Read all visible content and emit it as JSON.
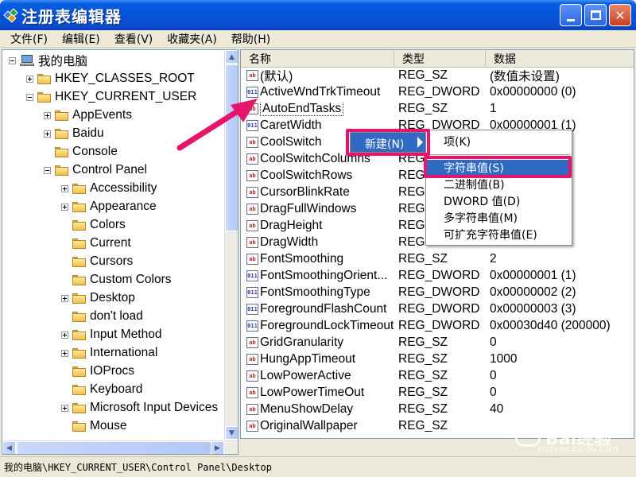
{
  "window": {
    "title": "注册表编辑器",
    "min_label": "",
    "max_label": "",
    "close_label": "✕"
  },
  "menu": [
    "文件(F)",
    "编辑(E)",
    "查看(V)",
    "收藏夹(A)",
    "帮助(H)"
  ],
  "tree": [
    {
      "label": "我的电脑",
      "indent": 0,
      "expander": "minus",
      "icon": "computer-icon"
    },
    {
      "label": "HKEY_CLASSES_ROOT",
      "indent": 1,
      "expander": "plus",
      "icon": "folder-icon"
    },
    {
      "label": "HKEY_CURRENT_USER",
      "indent": 1,
      "expander": "minus",
      "icon": "folder-icon"
    },
    {
      "label": "AppEvents",
      "indent": 2,
      "expander": "plus",
      "icon": "folder-icon"
    },
    {
      "label": "Baidu",
      "indent": 2,
      "expander": "plus",
      "icon": "folder-icon"
    },
    {
      "label": "Console",
      "indent": 2,
      "expander": "none",
      "icon": "folder-icon"
    },
    {
      "label": "Control Panel",
      "indent": 2,
      "expander": "minus",
      "icon": "folder-icon"
    },
    {
      "label": "Accessibility",
      "indent": 3,
      "expander": "plus",
      "icon": "folder-icon"
    },
    {
      "label": "Appearance",
      "indent": 3,
      "expander": "plus",
      "icon": "folder-icon"
    },
    {
      "label": "Colors",
      "indent": 3,
      "expander": "none",
      "icon": "folder-icon"
    },
    {
      "label": "Current",
      "indent": 3,
      "expander": "none",
      "icon": "folder-icon"
    },
    {
      "label": "Cursors",
      "indent": 3,
      "expander": "none",
      "icon": "folder-icon"
    },
    {
      "label": "Custom Colors",
      "indent": 3,
      "expander": "none",
      "icon": "folder-icon"
    },
    {
      "label": "Desktop",
      "indent": 3,
      "expander": "plus",
      "icon": "folder-open-icon"
    },
    {
      "label": "don't load",
      "indent": 3,
      "expander": "none",
      "icon": "folder-icon"
    },
    {
      "label": "Input Method",
      "indent": 3,
      "expander": "plus",
      "icon": "folder-icon"
    },
    {
      "label": "International",
      "indent": 3,
      "expander": "plus",
      "icon": "folder-icon"
    },
    {
      "label": "IOProcs",
      "indent": 3,
      "expander": "none",
      "icon": "folder-icon"
    },
    {
      "label": "Keyboard",
      "indent": 3,
      "expander": "none",
      "icon": "folder-icon"
    },
    {
      "label": "Microsoft Input Devices",
      "indent": 3,
      "expander": "plus",
      "icon": "folder-icon"
    },
    {
      "label": "Mouse",
      "indent": 3,
      "expander": "none",
      "icon": "folder-icon"
    }
  ],
  "columns": {
    "name": "名称",
    "type": "类型",
    "data": "数据"
  },
  "values": [
    {
      "name": "(默认)",
      "type": "REG_SZ",
      "data": "(数值未设置)",
      "kind": "sz"
    },
    {
      "name": "ActiveWndTrkTimeout",
      "type": "REG_DWORD",
      "data": "0x00000000 (0)",
      "kind": "dw"
    },
    {
      "name": "AutoEndTasks",
      "type": "REG_SZ",
      "data": "1",
      "kind": "sz"
    },
    {
      "name": "CaretWidth",
      "type": "REG_DWORD",
      "data": "0x00000001 (1)",
      "kind": "dw"
    },
    {
      "name": "CoolSwitch",
      "type": "",
      "data": "",
      "kind": "sz"
    },
    {
      "name": "CoolSwitchColumns",
      "type": "REG",
      "data": "",
      "kind": "sz"
    },
    {
      "name": "CoolSwitchRows",
      "type": "REG",
      "data": "",
      "kind": "sz"
    },
    {
      "name": "CursorBlinkRate",
      "type": "REG",
      "data": "",
      "kind": "sz"
    },
    {
      "name": "DragFullWindows",
      "type": "REG",
      "data": "",
      "kind": "sz"
    },
    {
      "name": "DragHeight",
      "type": "REG",
      "data": "",
      "kind": "sz"
    },
    {
      "name": "DragWidth",
      "type": "REG",
      "data": "",
      "kind": "sz"
    },
    {
      "name": "FontSmoothing",
      "type": "REG_SZ",
      "data": "2",
      "kind": "sz"
    },
    {
      "name": "FontSmoothingOrient...",
      "type": "REG_DWORD",
      "data": "0x00000001 (1)",
      "kind": "dw"
    },
    {
      "name": "FontSmoothingType",
      "type": "REG_DWORD",
      "data": "0x00000002 (2)",
      "kind": "dw"
    },
    {
      "name": "ForegroundFlashCount",
      "type": "REG_DWORD",
      "data": "0x00000003 (3)",
      "kind": "dw"
    },
    {
      "name": "ForegroundLockTimeout",
      "type": "REG_DWORD",
      "data": "0x00030d40 (200000)",
      "kind": "dw"
    },
    {
      "name": "GridGranularity",
      "type": "REG_SZ",
      "data": "0",
      "kind": "sz"
    },
    {
      "name": "HungAppTimeout",
      "type": "REG_SZ",
      "data": "1000",
      "kind": "sz"
    },
    {
      "name": "LowPowerActive",
      "type": "REG_SZ",
      "data": "0",
      "kind": "sz"
    },
    {
      "name": "LowPowerTimeOut",
      "type": "REG_SZ",
      "data": "0",
      "kind": "sz"
    },
    {
      "name": "MenuShowDelay",
      "type": "REG_SZ",
      "data": "40",
      "kind": "sz"
    },
    {
      "name": "OriginalWallpaper",
      "type": "REG_SZ",
      "data": "",
      "kind": "sz"
    }
  ],
  "context_menu": {
    "new_label": "新建(N)"
  },
  "submenu": [
    "项(K)",
    "字符串值(S)",
    "二进制值(B)",
    "DWORD 值(D)",
    "多字符串值(M)",
    "可扩充字符串值(E)"
  ],
  "status": "我的电脑\\HKEY_CURRENT_USER\\Control Panel\\Desktop",
  "watermark": {
    "brand": "Bai经验",
    "url": "jingyan.baidu.com"
  },
  "colors": {
    "titlebar": "#0453d9",
    "highlight": "#e8156c",
    "selection": "#316ac5"
  }
}
